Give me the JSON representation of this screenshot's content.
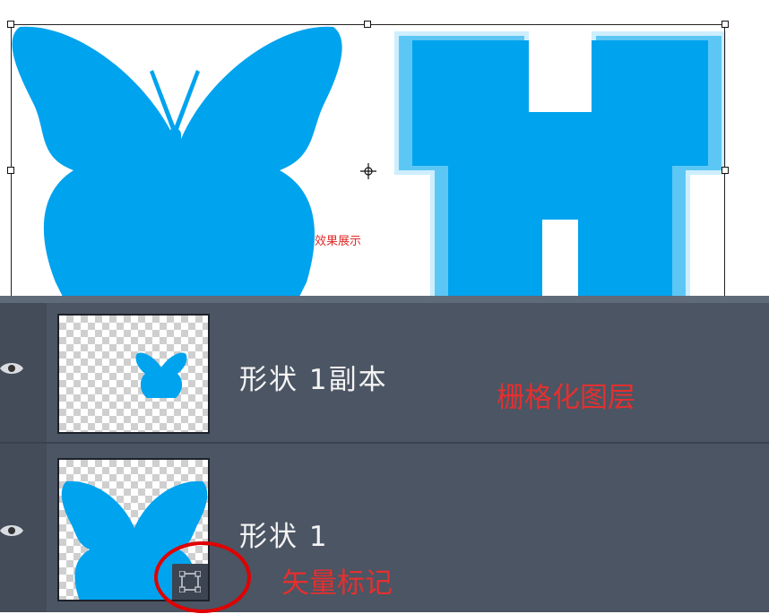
{
  "canvas": {
    "label": "效果展示"
  },
  "layers": [
    {
      "name": "形状 1副本",
      "annotation": "栅格化图层",
      "thumb_icon": "butterfly-small-icon"
    },
    {
      "name": "形状 1",
      "annotation": "矢量标记",
      "thumb_icon": "butterfly-large-icon",
      "badge_icon": "vector-mask-icon"
    }
  ],
  "colors": {
    "butterfly": "#00a3ee",
    "panel": "#4b5563",
    "annotation": "#e33030",
    "highlight_circle": "#e00000"
  }
}
